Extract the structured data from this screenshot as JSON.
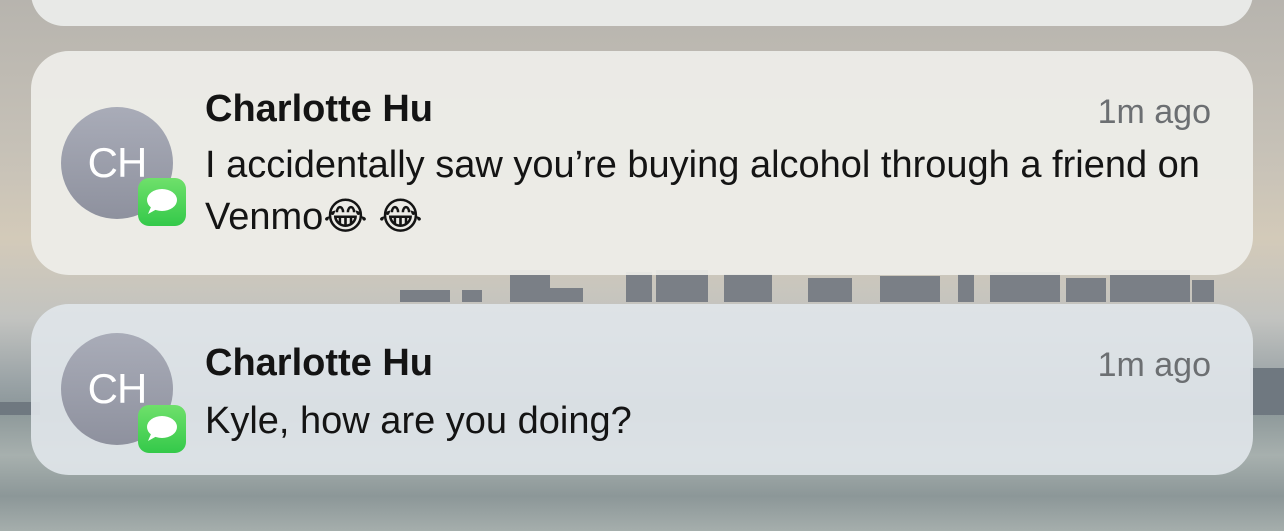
{
  "notifications": [
    {
      "avatar_initials": "CH",
      "sender": "Charlotte Hu",
      "time": "1m ago",
      "message": "I accidentally saw you’re buying alcohol through a friend on Venmo😂 😂",
      "app_icon": "messages-icon"
    },
    {
      "avatar_initials": "CH",
      "sender": "Charlotte Hu",
      "time": "1m ago",
      "message": "Kyle, how are you doing?",
      "app_icon": "messages-icon"
    }
  ],
  "colors": {
    "messages_green": "#34c94a",
    "avatar_gray": "#9a9daa",
    "time_gray": "#6c6f72"
  }
}
